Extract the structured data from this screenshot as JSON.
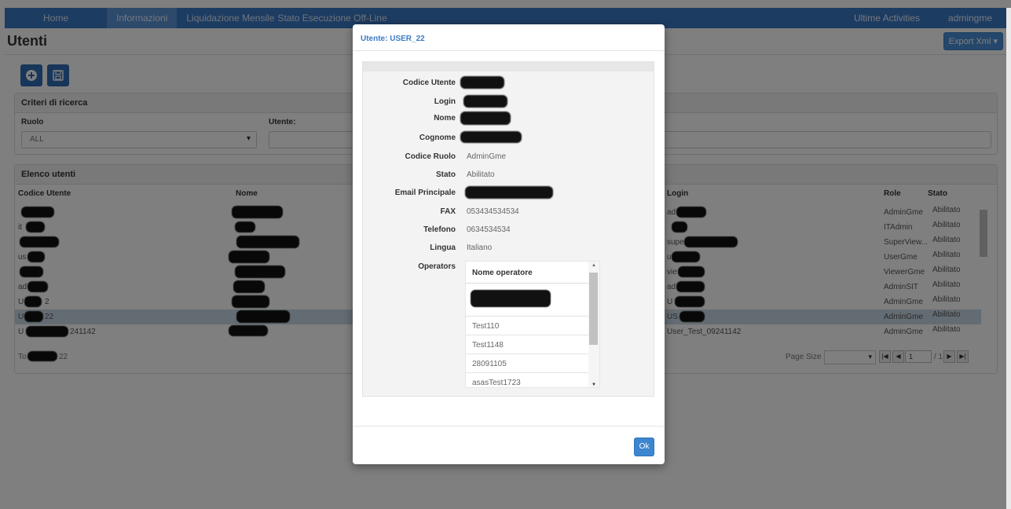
{
  "nav": {
    "home": "Home",
    "informazioni": "Informazioni",
    "liquidazione": "Liquidazione Mensile",
    "stato": "Stato Esecuzione Off-Line",
    "activities": "Ultime Activities",
    "user": "admingme"
  },
  "page": {
    "title": "Utenti",
    "export": "Export Xml"
  },
  "criteria": {
    "heading": "Criteri di ricerca",
    "ruolo_label": "Ruolo",
    "ruolo_value": "ALL",
    "utente_label": "Utente:"
  },
  "list": {
    "heading": "Elenco utenti",
    "columns": [
      "Codice Utente",
      "Nome",
      "Login",
      "Role",
      "Stato"
    ],
    "rows": [
      {
        "codice": "",
        "login": "ad",
        "role": "AdminGme",
        "stato": "Abilitato"
      },
      {
        "codice": "it",
        "login": "",
        "role": "ITAdmin",
        "stato": "Abilitato"
      },
      {
        "codice": "",
        "login": "supe",
        "role": "SuperView...",
        "stato": "Abilitato"
      },
      {
        "codice": "us",
        "login": "u",
        "role": "UserGme",
        "stato": "Abilitato"
      },
      {
        "codice": "",
        "login": "vie",
        "role": "ViewerGme",
        "stato": "Abilitato"
      },
      {
        "codice": "ad",
        "login": "ad",
        "role": "AdminSIT",
        "stato": "Abilitato"
      },
      {
        "codice": "U",
        "login": "U",
        "role": "AdminGme",
        "stato": "Abilitato"
      },
      {
        "codice": "U",
        "login": "US",
        "role": "AdminGme",
        "stato": "Abilitato"
      },
      {
        "codice": "U",
        "login": "User_Test_09241142",
        "role": "AdminGme",
        "stato": "Abilitato"
      }
    ],
    "footer_prefix": "To",
    "footer_suffix": "22",
    "page_size_label": "Page Size",
    "page_current": "1",
    "page_total": "/ 1"
  },
  "modal": {
    "title": "Utente: USER_22",
    "fields": {
      "codice_utente": "Codice Utente",
      "login": "Login",
      "nome": "Nome",
      "cognome": "Cognome",
      "codice_ruolo": "Codice Ruolo",
      "codice_ruolo_value": "AdminGme",
      "stato": "Stato",
      "stato_value": "Abilitato",
      "email": "Email Principale",
      "fax": "FAX",
      "fax_value": "053434534534",
      "telefono": "Telefono",
      "telefono_value": "0634534534",
      "lingua": "Lingua",
      "lingua_value": "Italiano",
      "operators": "Operators"
    },
    "operators": {
      "header": "Nome operatore",
      "items": [
        "",
        "Test110",
        "Test1148",
        "28091105",
        "asasTest1723"
      ]
    },
    "ok": "Ok"
  },
  "row_codice_extra": {
    "row9": "241142",
    "row8": "22",
    "row9b": "2"
  }
}
